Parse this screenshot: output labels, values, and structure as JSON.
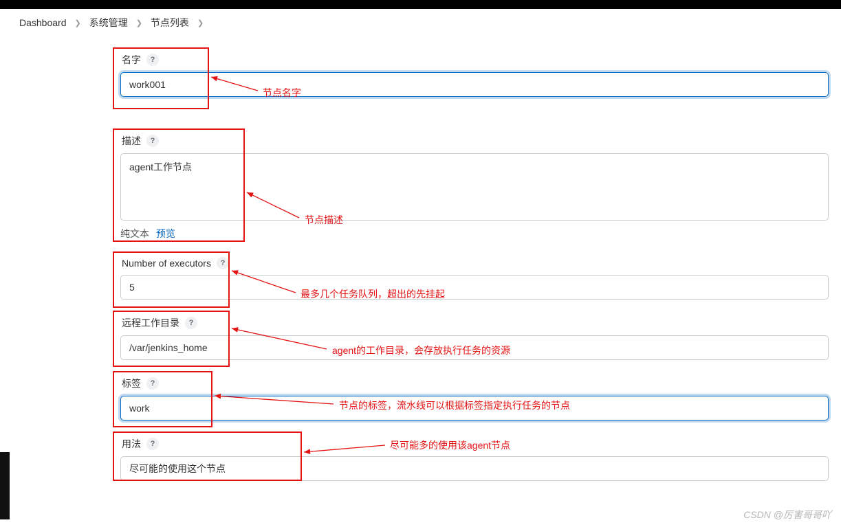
{
  "breadcrumb": {
    "dashboard": "Dashboard",
    "manage": "系统管理",
    "nodes": "节点列表"
  },
  "fields": {
    "name": {
      "label": "名字",
      "value": "work001"
    },
    "description": {
      "label": "描述",
      "value": "agent工作节点",
      "plain": "纯文本",
      "preview": "预览"
    },
    "executors": {
      "label": "Number of executors",
      "value": "5"
    },
    "remote": {
      "label": "远程工作目录",
      "value": "/var/jenkins_home"
    },
    "labels": {
      "label": "标签",
      "value": "work"
    },
    "usage": {
      "label": "用法",
      "value": "尽可能的使用这个节点"
    }
  },
  "annotations": {
    "name": "节点名字",
    "description": "节点描述",
    "executors": "最多几个任务队列，超出的先挂起",
    "remote": "agent的工作目录，会存放执行任务的资源",
    "labels": "节点的标签，流水线可以根据标签指定执行任务的节点",
    "usage": "尽可能多的使用该agent节点"
  },
  "help_glyph": "?",
  "watermark": "CSDN @厉害哥哥吖"
}
